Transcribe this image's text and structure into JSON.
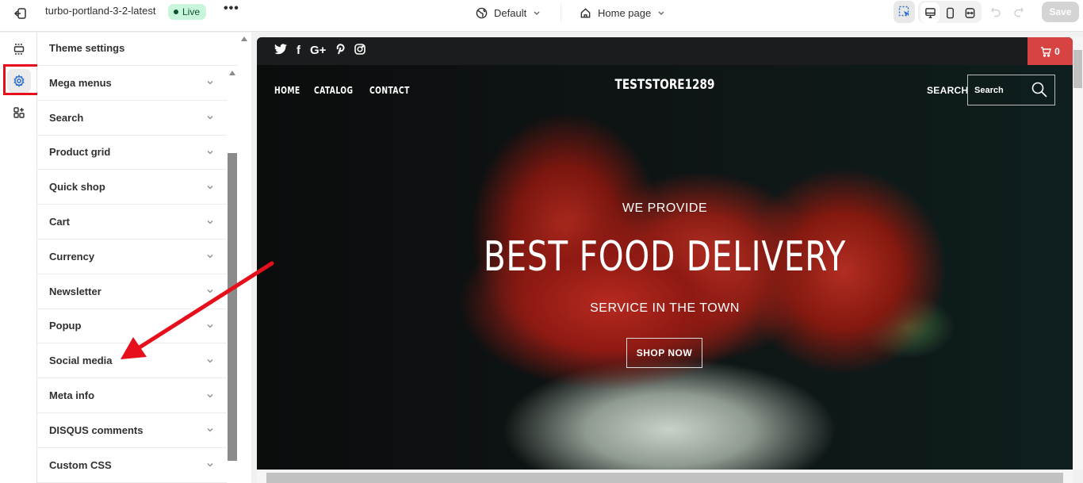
{
  "topbar": {
    "store_name": "turbo-portland-3-2-latest",
    "status_badge": "Live",
    "theme_dropdown": "Default",
    "page_dropdown": "Home page",
    "save_label": "Save"
  },
  "sidebar": {
    "title": "Theme settings",
    "items": [
      {
        "label": "Mega menus"
      },
      {
        "label": "Search"
      },
      {
        "label": "Product grid"
      },
      {
        "label": "Quick shop"
      },
      {
        "label": "Cart"
      },
      {
        "label": "Currency"
      },
      {
        "label": "Newsletter"
      },
      {
        "label": "Popup"
      },
      {
        "label": "Social media"
      },
      {
        "label": "Meta info"
      },
      {
        "label": "DISQUS comments"
      },
      {
        "label": "Custom CSS"
      }
    ]
  },
  "preview": {
    "social_icons": [
      "twitter-icon",
      "facebook-icon",
      "google-plus-icon",
      "pinterest-icon",
      "instagram-icon"
    ],
    "social_glyphs": {
      "twitter": "🐦",
      "facebook": "f",
      "google_plus": "G+",
      "pinterest": "P",
      "instagram": "◎"
    },
    "cart_count": "0",
    "nav": [
      "HOME",
      "CATALOG",
      "CONTACT"
    ],
    "store_logo": "TESTSTORE1289",
    "search_label": "SEARCH",
    "search_placeholder": "Search",
    "hero": {
      "kicker": "WE PROVIDE",
      "headline": "BEST FOOD DELIVERY",
      "subline": "SERVICE IN THE TOWN",
      "cta": "SHOP NOW"
    }
  },
  "colors": {
    "accent_blue": "#2c6ecb",
    "live_green": "#c8f5dc",
    "cart_red": "#d74342",
    "annotation_red": "#e5101b"
  }
}
